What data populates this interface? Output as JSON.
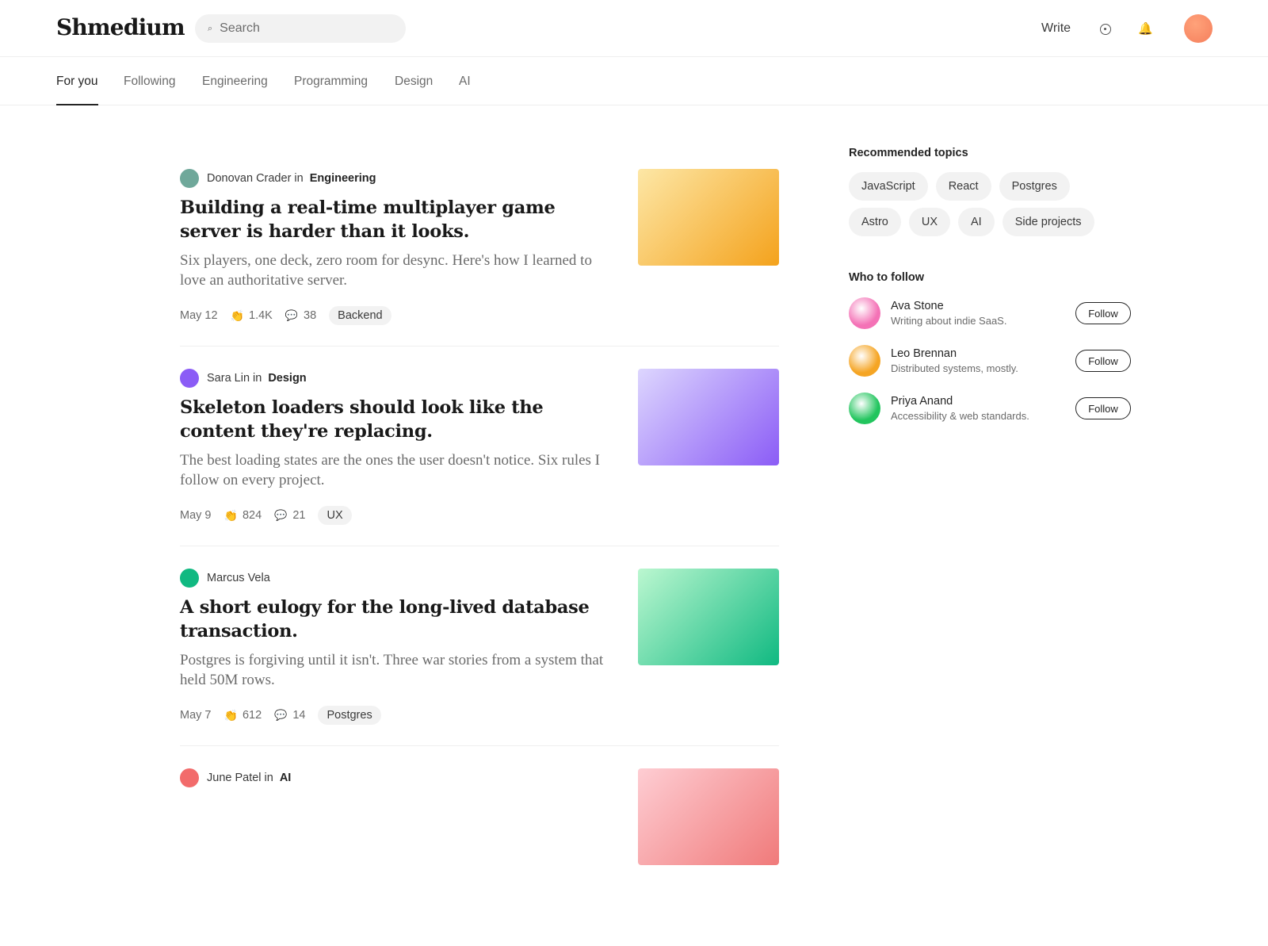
{
  "header": {
    "logo": "Shmedium",
    "search_placeholder": "Search",
    "write_label": "Write",
    "icons": [
      "search-icon",
      "plus-circle-icon",
      "bell-icon"
    ]
  },
  "tabs": [
    {
      "label": "For you",
      "active": true
    },
    {
      "label": "Following"
    },
    {
      "label": "Engineering"
    },
    {
      "label": "Programming"
    },
    {
      "label": "Design"
    },
    {
      "label": "AI"
    }
  ],
  "articles": [
    {
      "author": "Donovan Crader",
      "in": "in",
      "publication": "Engineering",
      "title": "Building a real-time multiplayer game server is harder than it looks.",
      "subtitle": "Six players, one deck, zero room for desync. Here's how I learned to love an authoritative server.",
      "date": "May 12",
      "claps": "1.4K",
      "comments": "38",
      "tag": "Backend",
      "avatar_color": "#6fa89a",
      "thumb_colors": [
        "#fde7a6",
        "#f4a21c"
      ]
    },
    {
      "author": "Sara Lin",
      "in": "in",
      "publication": "Design",
      "title": "Skeleton loaders should look like the content they're replacing.",
      "subtitle": "The best loading states are the ones the user doesn't notice. Six rules I follow on every project.",
      "date": "May 9",
      "claps": "824",
      "comments": "21",
      "tag": "UX",
      "avatar_color": "#8b5cf6",
      "thumb_colors": [
        "#ddd6fe",
        "#8b5cf6"
      ]
    },
    {
      "author": "Marcus Vela",
      "in": "",
      "publication": "",
      "title": "A short eulogy for the long-lived database transaction.",
      "subtitle": "Postgres is forgiving until it isn't. Three war stories from a system that held 50M rows.",
      "date": "May 7",
      "claps": "612",
      "comments": "14",
      "tag": "Postgres",
      "avatar_color": "#10b981",
      "thumb_colors": [
        "#bbf7d0",
        "#10b981"
      ]
    },
    {
      "author": "June Patel",
      "in": "in",
      "publication": "AI",
      "title": "",
      "subtitle": "",
      "date": "",
      "claps": "",
      "comments": "",
      "tag": "",
      "avatar_color": "#f26b6b",
      "thumb_colors": [
        "#fecdd3",
        "#f07a7a"
      ]
    }
  ],
  "sidebar": {
    "topics_heading": "Recommended topics",
    "topics": [
      "JavaScript",
      "React",
      "Postgres",
      "Astro",
      "UX",
      "AI",
      "Side projects"
    ],
    "follow_heading": "Who to follow",
    "people": [
      {
        "name": "Ava Stone",
        "bio": "Writing about indie SaaS.",
        "button": "Follow",
        "color": "#f472b6"
      },
      {
        "name": "Leo Brennan",
        "bio": "Distributed systems, mostly.",
        "button": "Follow",
        "color": "#f5a524"
      },
      {
        "name": "Priya Anand",
        "bio": "Accessibility & web standards.",
        "button": "Follow",
        "color": "#22c55e"
      }
    ]
  },
  "colors": {
    "text": "#242424",
    "muted": "#6b6b6b",
    "chip_bg": "#f2f2f2",
    "user_avatar": "#f57f5c"
  }
}
